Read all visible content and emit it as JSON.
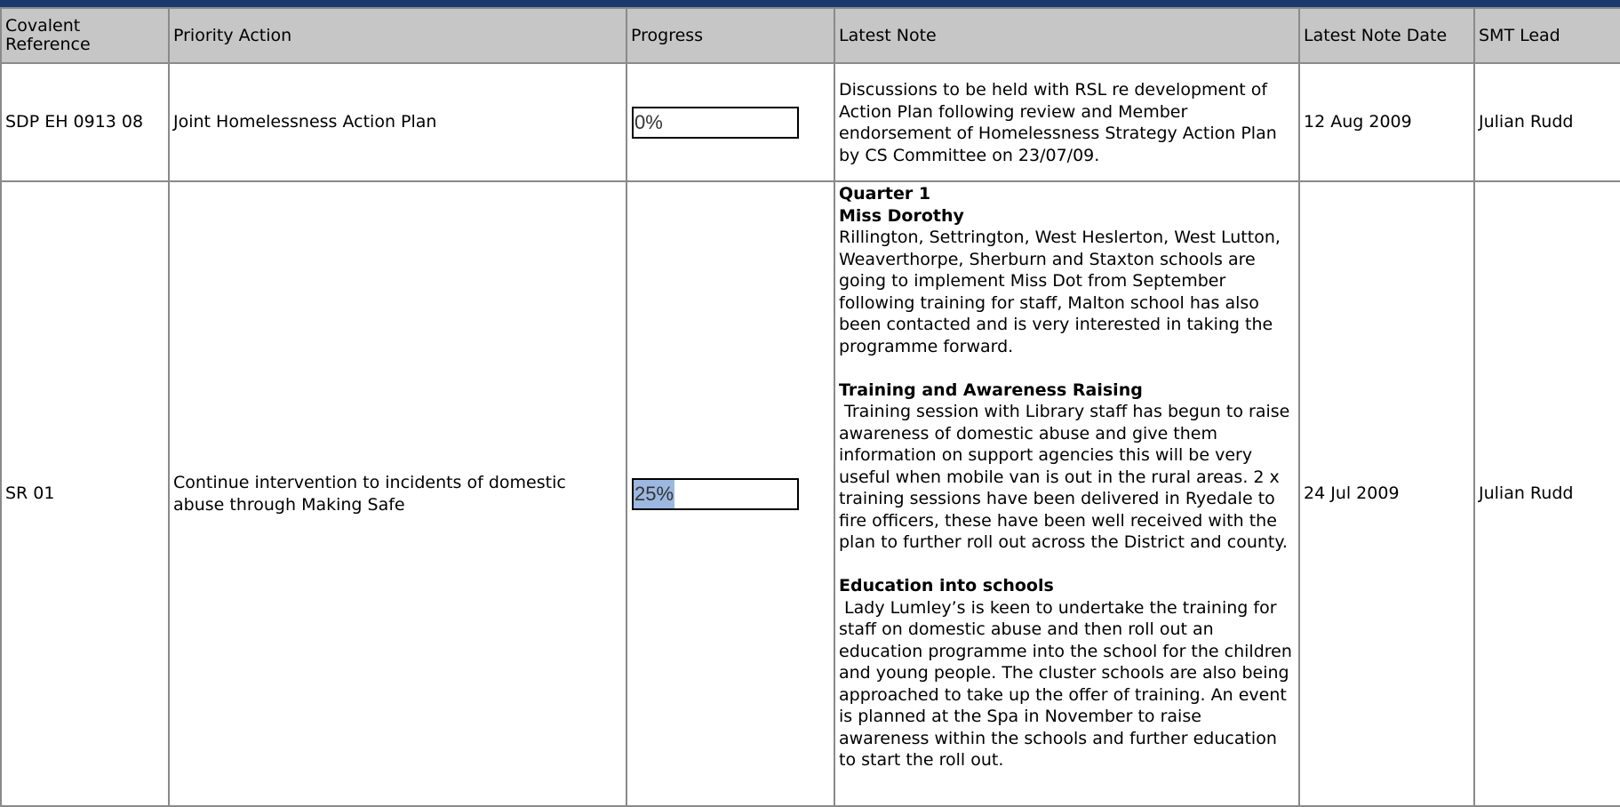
{
  "colors": {
    "header_band": "#1b3a6b",
    "header_bg": "#c6c6c6",
    "progress_fill": "#9cb8e0"
  },
  "columns": [
    "Covalent\nReference",
    "Priority Action",
    "Progress",
    "Latest Note",
    "Latest Note Date",
    "SMT Lead"
  ],
  "rows": [
    {
      "reference": "SDP EH 0913 08",
      "action": "Joint Homelessness Action Plan",
      "progress": {
        "value": 0,
        "label": "0%"
      },
      "note": "Discussions to be held with RSL re development of Action Plan following review and Member endorsement of Homelessness Strategy Action Plan by CS Committee on 23/07/09.",
      "date": "12 Aug 2009",
      "lead": "Julian Rudd"
    },
    {
      "reference": "SR 01",
      "action": "Continue intervention to incidents of domestic abuse through Making Safe",
      "progress": {
        "value": 25,
        "label": "25%"
      },
      "note_sections": {
        "quarter": "Quarter 1",
        "s1_title": "Miss Dorothy",
        "s1_text": "Rillington, Settrington, West Heslerton, West Lutton, Weaverthorpe, Sherburn and Staxton schools are going to implement Miss Dot from September following training for staff, Malton school has also been contacted and is very interested in taking the programme forward.",
        "s2_title": "Training and Awareness Raising",
        "s2_text": " Training session with Library staff has begun to raise awareness of domestic abuse and give them information on support agencies this will be very useful when mobile van is out in the rural areas. 2 x training sessions have been delivered in Ryedale to fire officers, these have been well received with the plan to further roll out across the District and county.",
        "s3_title": "Education into schools",
        "s3_text": " Lady Lumley’s is keen to undertake the training for staff on domestic abuse and then roll out an education programme into the school for the children and young people. The cluster schools are also being approached to take up the offer of training. An event is planned at the Spa in November to raise awareness within the schools and further education to start the roll out."
      },
      "date": "24 Jul 2009",
      "lead": "Julian Rudd"
    }
  ]
}
